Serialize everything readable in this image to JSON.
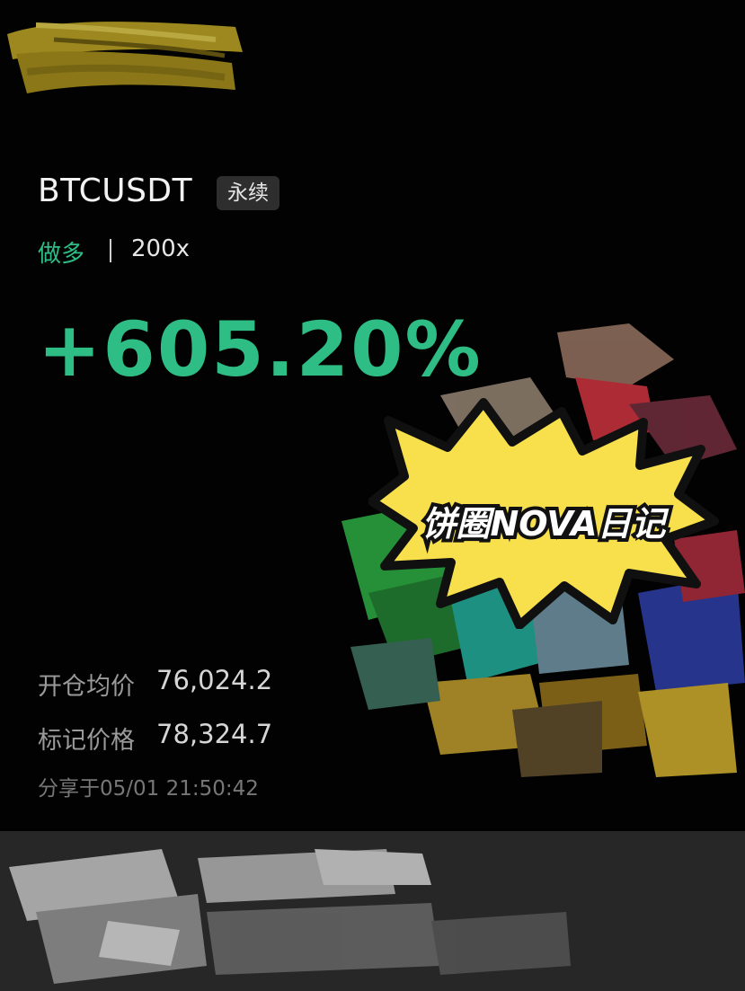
{
  "position": {
    "symbol": "BTCUSDT",
    "contract_type": "永续",
    "direction": "做多",
    "leverage": "200x",
    "pnl_percent": "+605.20%"
  },
  "details": {
    "entry_price_label": "开仓均价",
    "entry_price": "76,024.2",
    "mark_price_label": "标记价格",
    "mark_price": "78,324.7",
    "shared_at_label": "分享于",
    "shared_at": "05/01 21:50:42"
  },
  "watermark": {
    "text": "饼圈NOVA日记"
  },
  "colors": {
    "profit_green": "#2ebd85",
    "background": "#020202",
    "footer": "#272727",
    "burst_yellow": "#f7e04b"
  }
}
